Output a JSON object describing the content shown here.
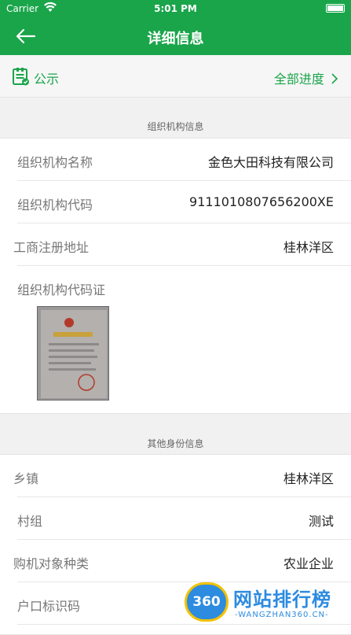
{
  "status_bar": {
    "carrier": "Carrier",
    "time": "5:01 PM"
  },
  "nav": {
    "title": "详细信息"
  },
  "notice": {
    "label": "公示",
    "progress_link": "全部进度"
  },
  "org_section": {
    "header": "组织机构信息",
    "rows": [
      {
        "label": "组织机构名称",
        "value": "金色大田科技有限公司"
      },
      {
        "label": "组织机构代码",
        "value": "9111010807656200XE"
      },
      {
        "label": "工商注册地址",
        "value": "桂林洋区"
      },
      {
        "label": "组织机构代码证",
        "value": ""
      }
    ]
  },
  "other_section": {
    "header": "其他身份信息",
    "rows": [
      {
        "label": "乡镇",
        "value": "桂林洋区"
      },
      {
        "label": "村组",
        "value": "测试"
      },
      {
        "label": "购机对象种类",
        "value": "农业企业"
      },
      {
        "label": "户口标识码",
        "value": ""
      }
    ]
  },
  "watermark": {
    "badge": "360",
    "text": "网站排行榜",
    "sub": "-WANGZHAN360.CN-"
  },
  "colors": {
    "brand": "#1aa54a",
    "watermark": "#2d8be0"
  }
}
